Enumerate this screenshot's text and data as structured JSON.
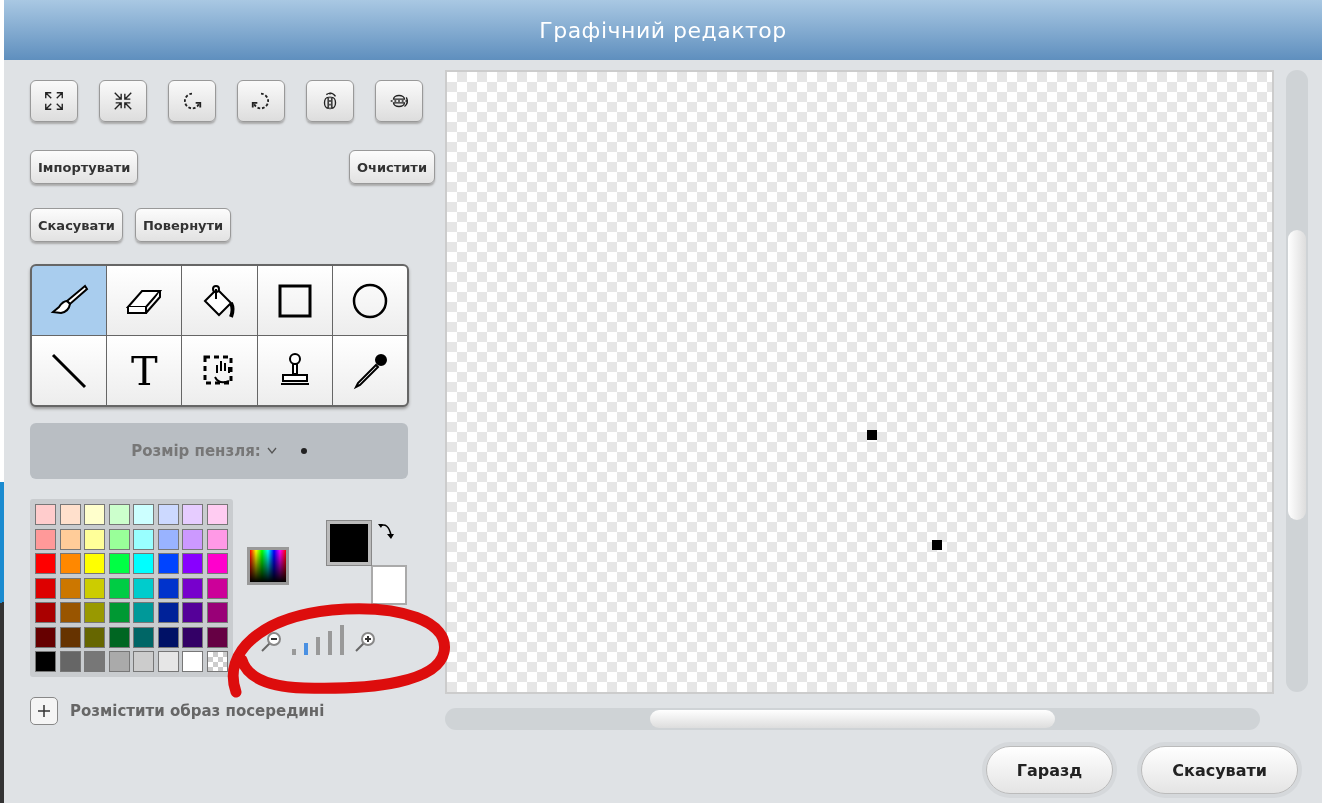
{
  "window": {
    "title": "Графічний редактор"
  },
  "transform_buttons": [
    {
      "kind": "grow"
    },
    {
      "kind": "shrink"
    },
    {
      "kind": "rotate-left"
    },
    {
      "kind": "rotate-right"
    },
    {
      "kind": "flip-horizontal"
    },
    {
      "kind": "flip-vertical"
    }
  ],
  "import_button": "Імпортувати",
  "clear_button": "Очистити",
  "undo_button": "Скасувати",
  "redo_button": "Повернути",
  "tools": [
    {
      "kind": "brush",
      "selected": true
    },
    {
      "kind": "eraser",
      "selected": false
    },
    {
      "kind": "fill",
      "selected": false
    },
    {
      "kind": "rectangle",
      "selected": false
    },
    {
      "kind": "ellipse",
      "selected": false
    },
    {
      "kind": "line",
      "selected": false
    },
    {
      "kind": "text",
      "glyph": "T",
      "selected": false
    },
    {
      "kind": "select",
      "selected": false
    },
    {
      "kind": "stamp",
      "selected": false
    },
    {
      "kind": "eyedropper",
      "selected": false
    }
  ],
  "brush_size": {
    "label": "Розмір пензля:"
  },
  "palette": [
    [
      {
        "kind": "solid",
        "color": "#ffcccc"
      },
      {
        "kind": "solid",
        "color": "#ffe0cc"
      },
      {
        "kind": "solid",
        "color": "#ffffcc"
      },
      {
        "kind": "solid",
        "color": "#ccffcc"
      },
      {
        "kind": "solid",
        "color": "#ccffff"
      },
      {
        "kind": "solid",
        "color": "#ccd9ff"
      },
      {
        "kind": "solid",
        "color": "#e6ccff"
      },
      {
        "kind": "solid",
        "color": "#ffccf2"
      }
    ],
    [
      {
        "kind": "solid",
        "color": "#ff9999"
      },
      {
        "kind": "solid",
        "color": "#ffcc99"
      },
      {
        "kind": "solid",
        "color": "#ffff99"
      },
      {
        "kind": "solid",
        "color": "#99ff99"
      },
      {
        "kind": "solid",
        "color": "#99ffff"
      },
      {
        "kind": "solid",
        "color": "#99b3ff"
      },
      {
        "kind": "solid",
        "color": "#cc99ff"
      },
      {
        "kind": "solid",
        "color": "#ff99e6"
      }
    ],
    [
      {
        "kind": "solid",
        "color": "#ff0000"
      },
      {
        "kind": "solid",
        "color": "#ff8800"
      },
      {
        "kind": "solid",
        "color": "#ffff00"
      },
      {
        "kind": "solid",
        "color": "#00ff44"
      },
      {
        "kind": "solid",
        "color": "#00ffff"
      },
      {
        "kind": "solid",
        "color": "#0044ff"
      },
      {
        "kind": "solid",
        "color": "#8800ff"
      },
      {
        "kind": "solid",
        "color": "#ff00cc"
      }
    ],
    [
      {
        "kind": "solid",
        "color": "#dd0000"
      },
      {
        "kind": "solid",
        "color": "#cc7700"
      },
      {
        "kind": "solid",
        "color": "#cccc00"
      },
      {
        "kind": "solid",
        "color": "#00cc44"
      },
      {
        "kind": "solid",
        "color": "#00cccc"
      },
      {
        "kind": "solid",
        "color": "#0033cc"
      },
      {
        "kind": "solid",
        "color": "#7700cc"
      },
      {
        "kind": "solid",
        "color": "#cc0099"
      }
    ],
    [
      {
        "kind": "solid",
        "color": "#aa0000"
      },
      {
        "kind": "solid",
        "color": "#995500"
      },
      {
        "kind": "solid",
        "color": "#999900"
      },
      {
        "kind": "solid",
        "color": "#009933"
      },
      {
        "kind": "solid",
        "color": "#009999"
      },
      {
        "kind": "solid",
        "color": "#002299"
      },
      {
        "kind": "solid",
        "color": "#550099"
      },
      {
        "kind": "solid",
        "color": "#990077"
      }
    ],
    [
      {
        "kind": "solid",
        "color": "#660000"
      },
      {
        "kind": "solid",
        "color": "#663300"
      },
      {
        "kind": "solid",
        "color": "#666600"
      },
      {
        "kind": "solid",
        "color": "#006622"
      },
      {
        "kind": "solid",
        "color": "#006666"
      },
      {
        "kind": "solid",
        "color": "#001166"
      },
      {
        "kind": "solid",
        "color": "#330066"
      },
      {
        "kind": "solid",
        "color": "#660044"
      }
    ],
    [
      {
        "kind": "solid",
        "color": "#000000"
      },
      {
        "kind": "solid",
        "color": "#666666"
      },
      {
        "kind": "solid",
        "color": "#777777"
      },
      {
        "kind": "solid",
        "color": "#aaaaaa"
      },
      {
        "kind": "solid",
        "color": "#cccccc"
      },
      {
        "kind": "solid",
        "color": "#e6e6e6"
      },
      {
        "kind": "solid",
        "color": "#ffffff"
      },
      {
        "kind": "transparent"
      }
    ]
  ],
  "pen_color": {
    "color": "#000000"
  },
  "background_color": {
    "color": "#ffffff"
  },
  "zoom_levels": [
    {
      "selected": false
    },
    {
      "selected": true
    },
    {
      "selected": false
    },
    {
      "selected": false
    },
    {
      "selected": false
    }
  ],
  "center_label": "Розмістити образ посередині",
  "buttons": [
    "Гаразд",
    "Скасувати"
  ]
}
